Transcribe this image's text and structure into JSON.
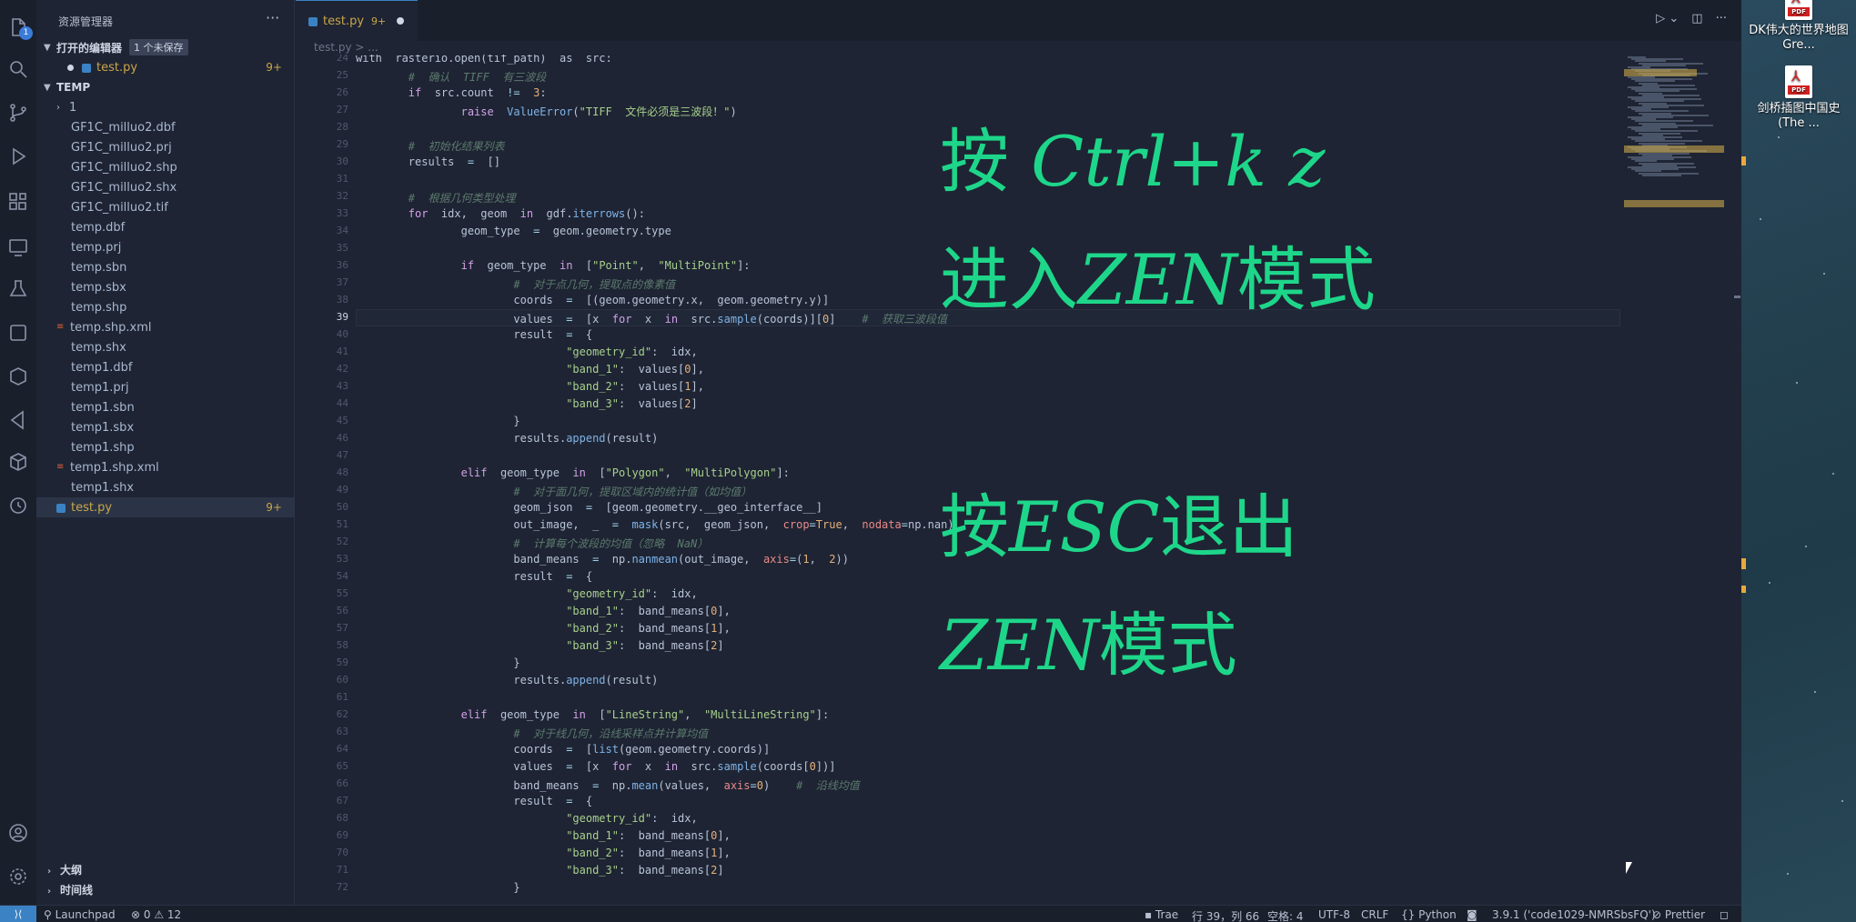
{
  "sidebar": {
    "title": "资源管理器",
    "open_editors": {
      "label": "打开的编辑器",
      "unsaved_badge": "1 个未保存",
      "file": "test.py",
      "count": "9+"
    },
    "folder": {
      "label": "TEMP"
    },
    "files": [
      {
        "name": "1",
        "kind": "folder",
        "count": ""
      },
      {
        "name": "GF1C_milluo2.dbf",
        "kind": "file",
        "count": ""
      },
      {
        "name": "GF1C_milluo2.prj",
        "kind": "file",
        "count": ""
      },
      {
        "name": "GF1C_milluo2.shp",
        "kind": "file",
        "count": ""
      },
      {
        "name": "GF1C_milluo2.shx",
        "kind": "file",
        "count": ""
      },
      {
        "name": "GF1C_milluo2.tif",
        "kind": "file",
        "count": ""
      },
      {
        "name": "temp.dbf",
        "kind": "file",
        "count": ""
      },
      {
        "name": "temp.prj",
        "kind": "file",
        "count": ""
      },
      {
        "name": "temp.sbn",
        "kind": "file",
        "count": ""
      },
      {
        "name": "temp.sbx",
        "kind": "file",
        "count": ""
      },
      {
        "name": "temp.shp",
        "kind": "file",
        "count": ""
      },
      {
        "name": "temp.shp.xml",
        "kind": "xml",
        "count": ""
      },
      {
        "name": "temp.shx",
        "kind": "file",
        "count": ""
      },
      {
        "name": "temp1.dbf",
        "kind": "file",
        "count": ""
      },
      {
        "name": "temp1.prj",
        "kind": "file",
        "count": ""
      },
      {
        "name": "temp1.sbn",
        "kind": "file",
        "count": ""
      },
      {
        "name": "temp1.sbx",
        "kind": "file",
        "count": ""
      },
      {
        "name": "temp1.shp",
        "kind": "file",
        "count": ""
      },
      {
        "name": "temp1.shp.xml",
        "kind": "xml",
        "count": ""
      },
      {
        "name": "temp1.shx",
        "kind": "file",
        "count": ""
      },
      {
        "name": "test.py",
        "kind": "py",
        "count": "9+"
      }
    ],
    "outline": "大纲",
    "timeline": "时间线"
  },
  "tab": {
    "name": "test.py",
    "count": "9+"
  },
  "breadcrumb": "test.py > ...",
  "code_lines": [
    {
      "n": "24",
      "html": "with  rasterio.open(tif_path)  as  src:"
    },
    {
      "n": "25",
      "html": "        <span class='c'>#  确认  TIFF  有三波段</span>"
    },
    {
      "n": "26",
      "html": "        <span class='k'>if</span>  src.count  <span class='o'>!=</span>  <span class='n'>3</span>:"
    },
    {
      "n": "27",
      "html": "                <span class='k'>raise</span>  <span class='f'>ValueError</span>(<span class='s'>\"TIFF  文件必须是三波段！\"</span>)"
    },
    {
      "n": "28",
      "html": ""
    },
    {
      "n": "29",
      "html": "        <span class='c'>#  初始化结果列表</span>"
    },
    {
      "n": "30",
      "html": "        results  <span class='o'>=</span>  []"
    },
    {
      "n": "31",
      "html": ""
    },
    {
      "n": "32",
      "html": "        <span class='c'>#  根据几何类型处理</span>"
    },
    {
      "n": "33",
      "html": "        <span class='k'>for</span>  idx,  geom  <span class='k'>in</span>  gdf.<span class='f'>iterrows</span>():"
    },
    {
      "n": "34",
      "html": "                geom_type  <span class='o'>=</span>  geom.geometry.type"
    },
    {
      "n": "35",
      "html": ""
    },
    {
      "n": "36",
      "html": "                <span class='k'>if</span>  geom_type  <span class='k'>in</span>  [<span class='s'>\"Point\"</span>,  <span class='s'>\"MultiPoint\"</span>]:"
    },
    {
      "n": "37",
      "html": "                        <span class='c'>#  对于点几何，提取点的像素值</span>"
    },
    {
      "n": "38",
      "html": "                        coords  <span class='o'>=</span>  [(geom.geometry.x,  geom.geometry.y)]"
    },
    {
      "n": "39",
      "html": "                        values  <span class='o'>=</span>  [x  <span class='k'>for</span>  x  <span class='k'>in</span>  src.<span class='f'>sample</span>(coords)][<span class='n'>0</span>]    <span class='c'>#  获取三波段值</span>"
    },
    {
      "n": "40",
      "html": "                        result  <span class='o'>=</span>  {"
    },
    {
      "n": "41",
      "html": "                                <span class='s'>\"geometry_id\"</span>:  idx,"
    },
    {
      "n": "42",
      "html": "                                <span class='s'>\"band_1\"</span>:  values[<span class='n'>0</span>],"
    },
    {
      "n": "43",
      "html": "                                <span class='s'>\"band_2\"</span>:  values[<span class='n'>1</span>],"
    },
    {
      "n": "44",
      "html": "                                <span class='s'>\"band_3\"</span>:  values[<span class='n'>2</span>]"
    },
    {
      "n": "45",
      "html": "                        }"
    },
    {
      "n": "46",
      "html": "                        results.<span class='f'>append</span>(result)"
    },
    {
      "n": "47",
      "html": ""
    },
    {
      "n": "48",
      "html": "                <span class='k'>elif</span>  geom_type  <span class='k'>in</span>  [<span class='s'>\"Polygon\"</span>,  <span class='s'>\"MultiPolygon\"</span>]:"
    },
    {
      "n": "49",
      "html": "                        <span class='c'>#  对于面几何，提取区域内的统计值（如均值）</span>"
    },
    {
      "n": "50",
      "html": "                        geom_json  <span class='o'>=</span>  [geom.geometry.__geo_interface__]"
    },
    {
      "n": "51",
      "html": "                        out_image,  _  <span class='o'>=</span>  <span class='f'>mask</span>(src,  geom_json,  <span class='p'>crop</span><span class='o'>=</span><span class='n'>True</span>,  <span class='p'>nodata</span><span class='o'>=</span>np.nan)"
    },
    {
      "n": "52",
      "html": "                        <span class='c'>#  计算每个波段的均值（忽略  NaN）</span>"
    },
    {
      "n": "53",
      "html": "                        band_means  <span class='o'>=</span>  np.<span class='f'>nanmean</span>(out_image,  <span class='p'>axis</span><span class='o'>=</span>(<span class='n'>1</span>,  <span class='n'>2</span>))"
    },
    {
      "n": "54",
      "html": "                        result  <span class='o'>=</span>  {"
    },
    {
      "n": "55",
      "html": "                                <span class='s'>\"geometry_id\"</span>:  idx,"
    },
    {
      "n": "56",
      "html": "                                <span class='s'>\"band_1\"</span>:  band_means[<span class='n'>0</span>],"
    },
    {
      "n": "57",
      "html": "                                <span class='s'>\"band_2\"</span>:  band_means[<span class='n'>1</span>],"
    },
    {
      "n": "58",
      "html": "                                <span class='s'>\"band_3\"</span>:  band_means[<span class='n'>2</span>]"
    },
    {
      "n": "59",
      "html": "                        }"
    },
    {
      "n": "60",
      "html": "                        results.<span class='f'>append</span>(result)"
    },
    {
      "n": "61",
      "html": ""
    },
    {
      "n": "62",
      "html": "                <span class='k'>elif</span>  geom_type  <span class='k'>in</span>  [<span class='s'>\"LineString\"</span>,  <span class='s'>\"MultiLineString\"</span>]:"
    },
    {
      "n": "63",
      "html": "                        <span class='c'>#  对于线几何，沿线采样点并计算均值</span>"
    },
    {
      "n": "64",
      "html": "                        coords  <span class='o'>=</span>  [<span class='f'>list</span>(geom.geometry.coords)]"
    },
    {
      "n": "65",
      "html": "                        values  <span class='o'>=</span>  [x  <span class='k'>for</span>  x  <span class='k'>in</span>  src.<span class='f'>sample</span>(coords[<span class='n'>0</span>])]"
    },
    {
      "n": "66",
      "html": "                        band_means  <span class='o'>=</span>  np.<span class='f'>mean</span>(values,  <span class='p'>axis</span><span class='o'>=</span><span class='n'>0</span>)    <span class='c'>#  沿线均值</span>"
    },
    {
      "n": "67",
      "html": "                        result  <span class='o'>=</span>  {"
    },
    {
      "n": "68",
      "html": "                                <span class='s'>\"geometry_id\"</span>:  idx,"
    },
    {
      "n": "69",
      "html": "                                <span class='s'>\"band_1\"</span>:  band_means[<span class='n'>0</span>],"
    },
    {
      "n": "70",
      "html": "                                <span class='s'>\"band_2\"</span>:  band_means[<span class='n'>1</span>],"
    },
    {
      "n": "71",
      "html": "                                <span class='s'>\"band_3\"</span>:  band_means[<span class='n'>2</span>]"
    },
    {
      "n": "72",
      "html": "                        }"
    }
  ],
  "current_line": "39",
  "overlay": {
    "line1_a": "按 ",
    "line1_b": "Ctrl+k  z",
    "line2_a": "进入",
    "line2_b": "ZEN",
    "line2_c": "模式",
    "line3_a": "按",
    "line3_b": "ESC",
    "line3_c": "退出",
    "line4_a": "ZEN",
    "line4_b": "模式",
    "color": "#1ed68a"
  },
  "desktop": {
    "icon1": "DK伟大的世界地图 Gre...",
    "icon2": "剑桥插图中国史 (The ..."
  },
  "status": {
    "launchpad": "Launchpad",
    "problems": "⊗ 0 ⚠ 12",
    "trae": "Trae",
    "position": "行 39，列 66",
    "spaces": "空格: 4",
    "encoding": "UTF-8",
    "eol": "CRLF",
    "language": "Python",
    "interpreter": "3.9.1 ('code1029-NMRSbsFQ')",
    "prettier": "Prettier"
  },
  "colors": {
    "accent": "#3b82c4",
    "warning": "#c9a64a",
    "overlay": "#1ed68a"
  }
}
